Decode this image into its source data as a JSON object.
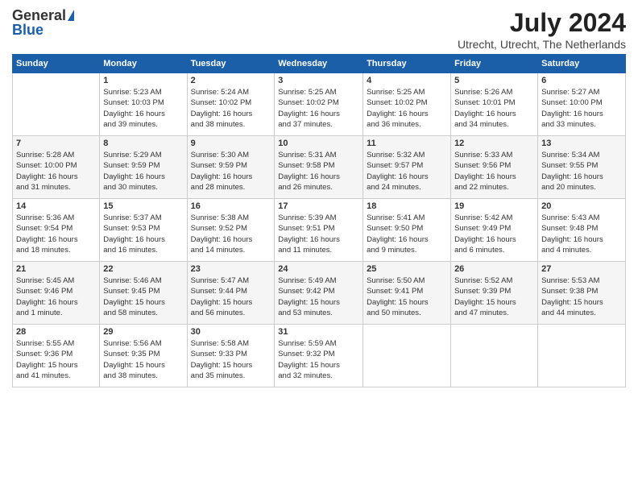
{
  "header": {
    "logo_general": "General",
    "logo_blue": "Blue",
    "month_title": "July 2024",
    "location": "Utrecht, Utrecht, The Netherlands"
  },
  "calendar": {
    "days_of_week": [
      "Sunday",
      "Monday",
      "Tuesday",
      "Wednesday",
      "Thursday",
      "Friday",
      "Saturday"
    ],
    "weeks": [
      [
        {
          "day": "",
          "info": ""
        },
        {
          "day": "1",
          "info": "Sunrise: 5:23 AM\nSunset: 10:03 PM\nDaylight: 16 hours\nand 39 minutes."
        },
        {
          "day": "2",
          "info": "Sunrise: 5:24 AM\nSunset: 10:02 PM\nDaylight: 16 hours\nand 38 minutes."
        },
        {
          "day": "3",
          "info": "Sunrise: 5:25 AM\nSunset: 10:02 PM\nDaylight: 16 hours\nand 37 minutes."
        },
        {
          "day": "4",
          "info": "Sunrise: 5:25 AM\nSunset: 10:02 PM\nDaylight: 16 hours\nand 36 minutes."
        },
        {
          "day": "5",
          "info": "Sunrise: 5:26 AM\nSunset: 10:01 PM\nDaylight: 16 hours\nand 34 minutes."
        },
        {
          "day": "6",
          "info": "Sunrise: 5:27 AM\nSunset: 10:00 PM\nDaylight: 16 hours\nand 33 minutes."
        }
      ],
      [
        {
          "day": "7",
          "info": "Sunrise: 5:28 AM\nSunset: 10:00 PM\nDaylight: 16 hours\nand 31 minutes."
        },
        {
          "day": "8",
          "info": "Sunrise: 5:29 AM\nSunset: 9:59 PM\nDaylight: 16 hours\nand 30 minutes."
        },
        {
          "day": "9",
          "info": "Sunrise: 5:30 AM\nSunset: 9:59 PM\nDaylight: 16 hours\nand 28 minutes."
        },
        {
          "day": "10",
          "info": "Sunrise: 5:31 AM\nSunset: 9:58 PM\nDaylight: 16 hours\nand 26 minutes."
        },
        {
          "day": "11",
          "info": "Sunrise: 5:32 AM\nSunset: 9:57 PM\nDaylight: 16 hours\nand 24 minutes."
        },
        {
          "day": "12",
          "info": "Sunrise: 5:33 AM\nSunset: 9:56 PM\nDaylight: 16 hours\nand 22 minutes."
        },
        {
          "day": "13",
          "info": "Sunrise: 5:34 AM\nSunset: 9:55 PM\nDaylight: 16 hours\nand 20 minutes."
        }
      ],
      [
        {
          "day": "14",
          "info": "Sunrise: 5:36 AM\nSunset: 9:54 PM\nDaylight: 16 hours\nand 18 minutes."
        },
        {
          "day": "15",
          "info": "Sunrise: 5:37 AM\nSunset: 9:53 PM\nDaylight: 16 hours\nand 16 minutes."
        },
        {
          "day": "16",
          "info": "Sunrise: 5:38 AM\nSunset: 9:52 PM\nDaylight: 16 hours\nand 14 minutes."
        },
        {
          "day": "17",
          "info": "Sunrise: 5:39 AM\nSunset: 9:51 PM\nDaylight: 16 hours\nand 11 minutes."
        },
        {
          "day": "18",
          "info": "Sunrise: 5:41 AM\nSunset: 9:50 PM\nDaylight: 16 hours\nand 9 minutes."
        },
        {
          "day": "19",
          "info": "Sunrise: 5:42 AM\nSunset: 9:49 PM\nDaylight: 16 hours\nand 6 minutes."
        },
        {
          "day": "20",
          "info": "Sunrise: 5:43 AM\nSunset: 9:48 PM\nDaylight: 16 hours\nand 4 minutes."
        }
      ],
      [
        {
          "day": "21",
          "info": "Sunrise: 5:45 AM\nSunset: 9:46 PM\nDaylight: 16 hours\nand 1 minute."
        },
        {
          "day": "22",
          "info": "Sunrise: 5:46 AM\nSunset: 9:45 PM\nDaylight: 15 hours\nand 58 minutes."
        },
        {
          "day": "23",
          "info": "Sunrise: 5:47 AM\nSunset: 9:44 PM\nDaylight: 15 hours\nand 56 minutes."
        },
        {
          "day": "24",
          "info": "Sunrise: 5:49 AM\nSunset: 9:42 PM\nDaylight: 15 hours\nand 53 minutes."
        },
        {
          "day": "25",
          "info": "Sunrise: 5:50 AM\nSunset: 9:41 PM\nDaylight: 15 hours\nand 50 minutes."
        },
        {
          "day": "26",
          "info": "Sunrise: 5:52 AM\nSunset: 9:39 PM\nDaylight: 15 hours\nand 47 minutes."
        },
        {
          "day": "27",
          "info": "Sunrise: 5:53 AM\nSunset: 9:38 PM\nDaylight: 15 hours\nand 44 minutes."
        }
      ],
      [
        {
          "day": "28",
          "info": "Sunrise: 5:55 AM\nSunset: 9:36 PM\nDaylight: 15 hours\nand 41 minutes."
        },
        {
          "day": "29",
          "info": "Sunrise: 5:56 AM\nSunset: 9:35 PM\nDaylight: 15 hours\nand 38 minutes."
        },
        {
          "day": "30",
          "info": "Sunrise: 5:58 AM\nSunset: 9:33 PM\nDaylight: 15 hours\nand 35 minutes."
        },
        {
          "day": "31",
          "info": "Sunrise: 5:59 AM\nSunset: 9:32 PM\nDaylight: 15 hours\nand 32 minutes."
        },
        {
          "day": "",
          "info": ""
        },
        {
          "day": "",
          "info": ""
        },
        {
          "day": "",
          "info": ""
        }
      ]
    ]
  }
}
